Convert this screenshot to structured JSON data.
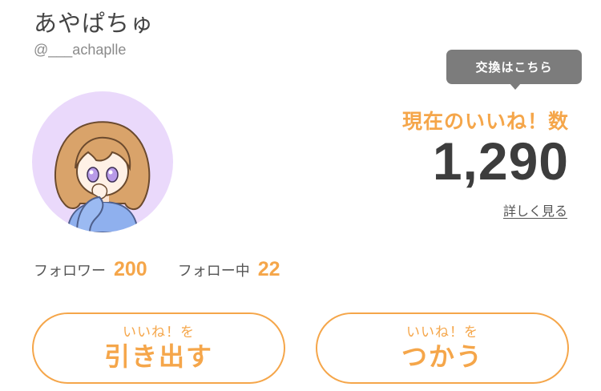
{
  "profile": {
    "display_name": "あやぱちゅ",
    "handle": "@___achaplle"
  },
  "likes": {
    "tooltip": "交換はこちら",
    "label": "現在のいいね！数",
    "count": "1,290",
    "details_link": "詳しく見る"
  },
  "stats": {
    "followers_label": "フォロワー",
    "followers_value": "200",
    "following_label": "フォロー中",
    "following_value": "22"
  },
  "actions": {
    "withdraw": {
      "sub": "いいね！を",
      "main": "引き出す"
    },
    "use": {
      "sub": "いいね！を",
      "main": "つかう"
    }
  },
  "colors": {
    "accent": "#f5a64a",
    "tooltip_bg": "#7c7c7c",
    "avatar_bg": "#ead9fb"
  },
  "icons": {
    "avatar": "illustrated-girl-avatar"
  }
}
